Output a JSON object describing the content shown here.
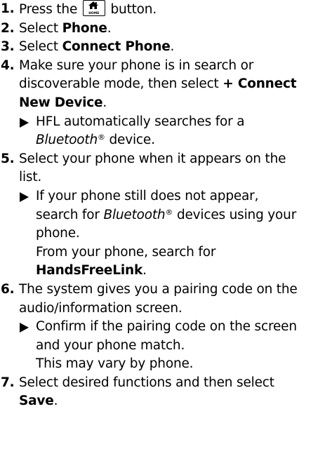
{
  "steps": [
    {
      "num": "1.",
      "text_before": "Press the",
      "button_label": "HOME",
      "text_after": " button."
    },
    {
      "num": "2.",
      "text": "Select ",
      "bold": "Phone",
      "tail": "."
    },
    {
      "num": "3.",
      "text": "Select ",
      "bold": "Connect Phone",
      "tail": "."
    },
    {
      "num": "4.",
      "text_line1": "Make sure your phone is in search or",
      "text_line2": "discoverable mode, then select ",
      "bold_a": "+ Connect",
      "bold_b": "New Device",
      "tail": "."
    },
    {
      "num": "5.",
      "text_line1": "Select your phone when it appears on the",
      "text_line2": "list."
    },
    {
      "num": "6.",
      "text_line1": "The system gives you a pairing code on the",
      "text_line2": "audio/information screen."
    },
    {
      "num": "7.",
      "text_line1": "Select desired functions and then select",
      "bold": "Save",
      "tail": "."
    }
  ],
  "notes": {
    "step4": {
      "line1": "HFL automatically searches for a",
      "italic": "Bluetooth",
      "reg": "®",
      "after": " device."
    },
    "step5": {
      "line1": "If your phone still does not appear,",
      "line2_before": "search for ",
      "italic": "Bluetooth",
      "reg": "®",
      "line2_after": " devices using your",
      "line3": "phone.",
      "line4": "From your phone, search for",
      "bold": "HandsFreeLink",
      "tail": "."
    },
    "step6": {
      "line1": "Confirm if the pairing code on the screen",
      "line2": "and your phone match.",
      "line3": "This may vary by phone."
    }
  },
  "icons": {
    "home_button": "home-icon",
    "note_marker": "triangle-right-icon"
  }
}
